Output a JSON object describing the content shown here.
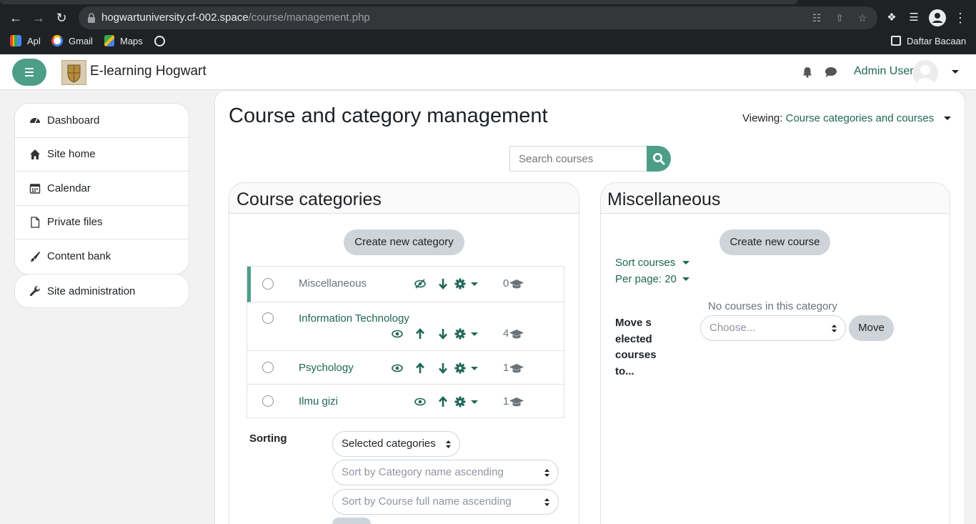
{
  "browser": {
    "url_host": "hogwartuniversity.cf-002.space",
    "url_path": "/course/management.php",
    "bookmarks": [
      "Apl",
      "Gmail",
      "Maps"
    ],
    "reading_list": "Daftar Bacaan"
  },
  "navbar": {
    "site_name": "E-learning Hogwart",
    "user_name": "Admin User"
  },
  "nav": {
    "items": [
      {
        "label": "Dashboard",
        "icon": "dashboard-icon"
      },
      {
        "label": "Site home",
        "icon": "home-icon"
      },
      {
        "label": "Calendar",
        "icon": "calendar-icon"
      },
      {
        "label": "Private files",
        "icon": "file-icon"
      },
      {
        "label": "Content bank",
        "icon": "paintbrush-icon"
      }
    ],
    "site_admin": "Site administration"
  },
  "page": {
    "title": "Course and category management",
    "viewing_label": "Viewing:",
    "viewing_value": "Course categories and courses",
    "search_placeholder": "Search courses"
  },
  "categories": {
    "title": "Course categories",
    "create_button": "Create new category",
    "rows": [
      {
        "name": "Miscellaneous",
        "count": "0",
        "selected_row": true,
        "hidden": true
      },
      {
        "name": "Information Technology",
        "count": "4",
        "selected_row": false,
        "hidden": false
      },
      {
        "name": "Psychology",
        "count": "1",
        "selected_row": false,
        "hidden": false
      },
      {
        "name": "Ilmu gizi",
        "count": "1",
        "selected_row": false,
        "hidden": false
      }
    ],
    "sorting_label": "Sorting",
    "sort_scope": "Selected categories",
    "sort_category": "Sort by Category name ascending",
    "sort_course": "Sort by Course full name ascending"
  },
  "courses": {
    "title": "Miscellaneous",
    "create_button": "Create new course",
    "sort_courses": "Sort courses",
    "per_page": "Per page: 20",
    "empty_message": "No courses in this category",
    "move_label": "Move selected courses to...",
    "choose_placeholder": "Choose...",
    "move_button": "Move"
  },
  "colors": {
    "accent": "#4c9e87",
    "link": "#1f6656",
    "chrome_bg": "#202124"
  }
}
